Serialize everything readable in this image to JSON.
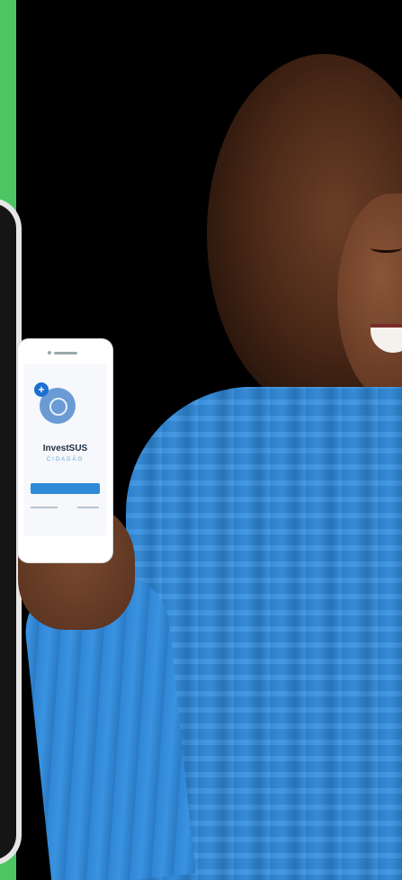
{
  "app": {
    "name": "InvestSUS",
    "subtitle": "CIDADÃO"
  },
  "colors": {
    "green_strip": "#4cc563",
    "sweater_blue": "#2f86d6",
    "app_button": "#2e8ad7",
    "background": "#000000"
  },
  "icons": [
    "investsus-logo-icon",
    "plus-badge-icon"
  ]
}
